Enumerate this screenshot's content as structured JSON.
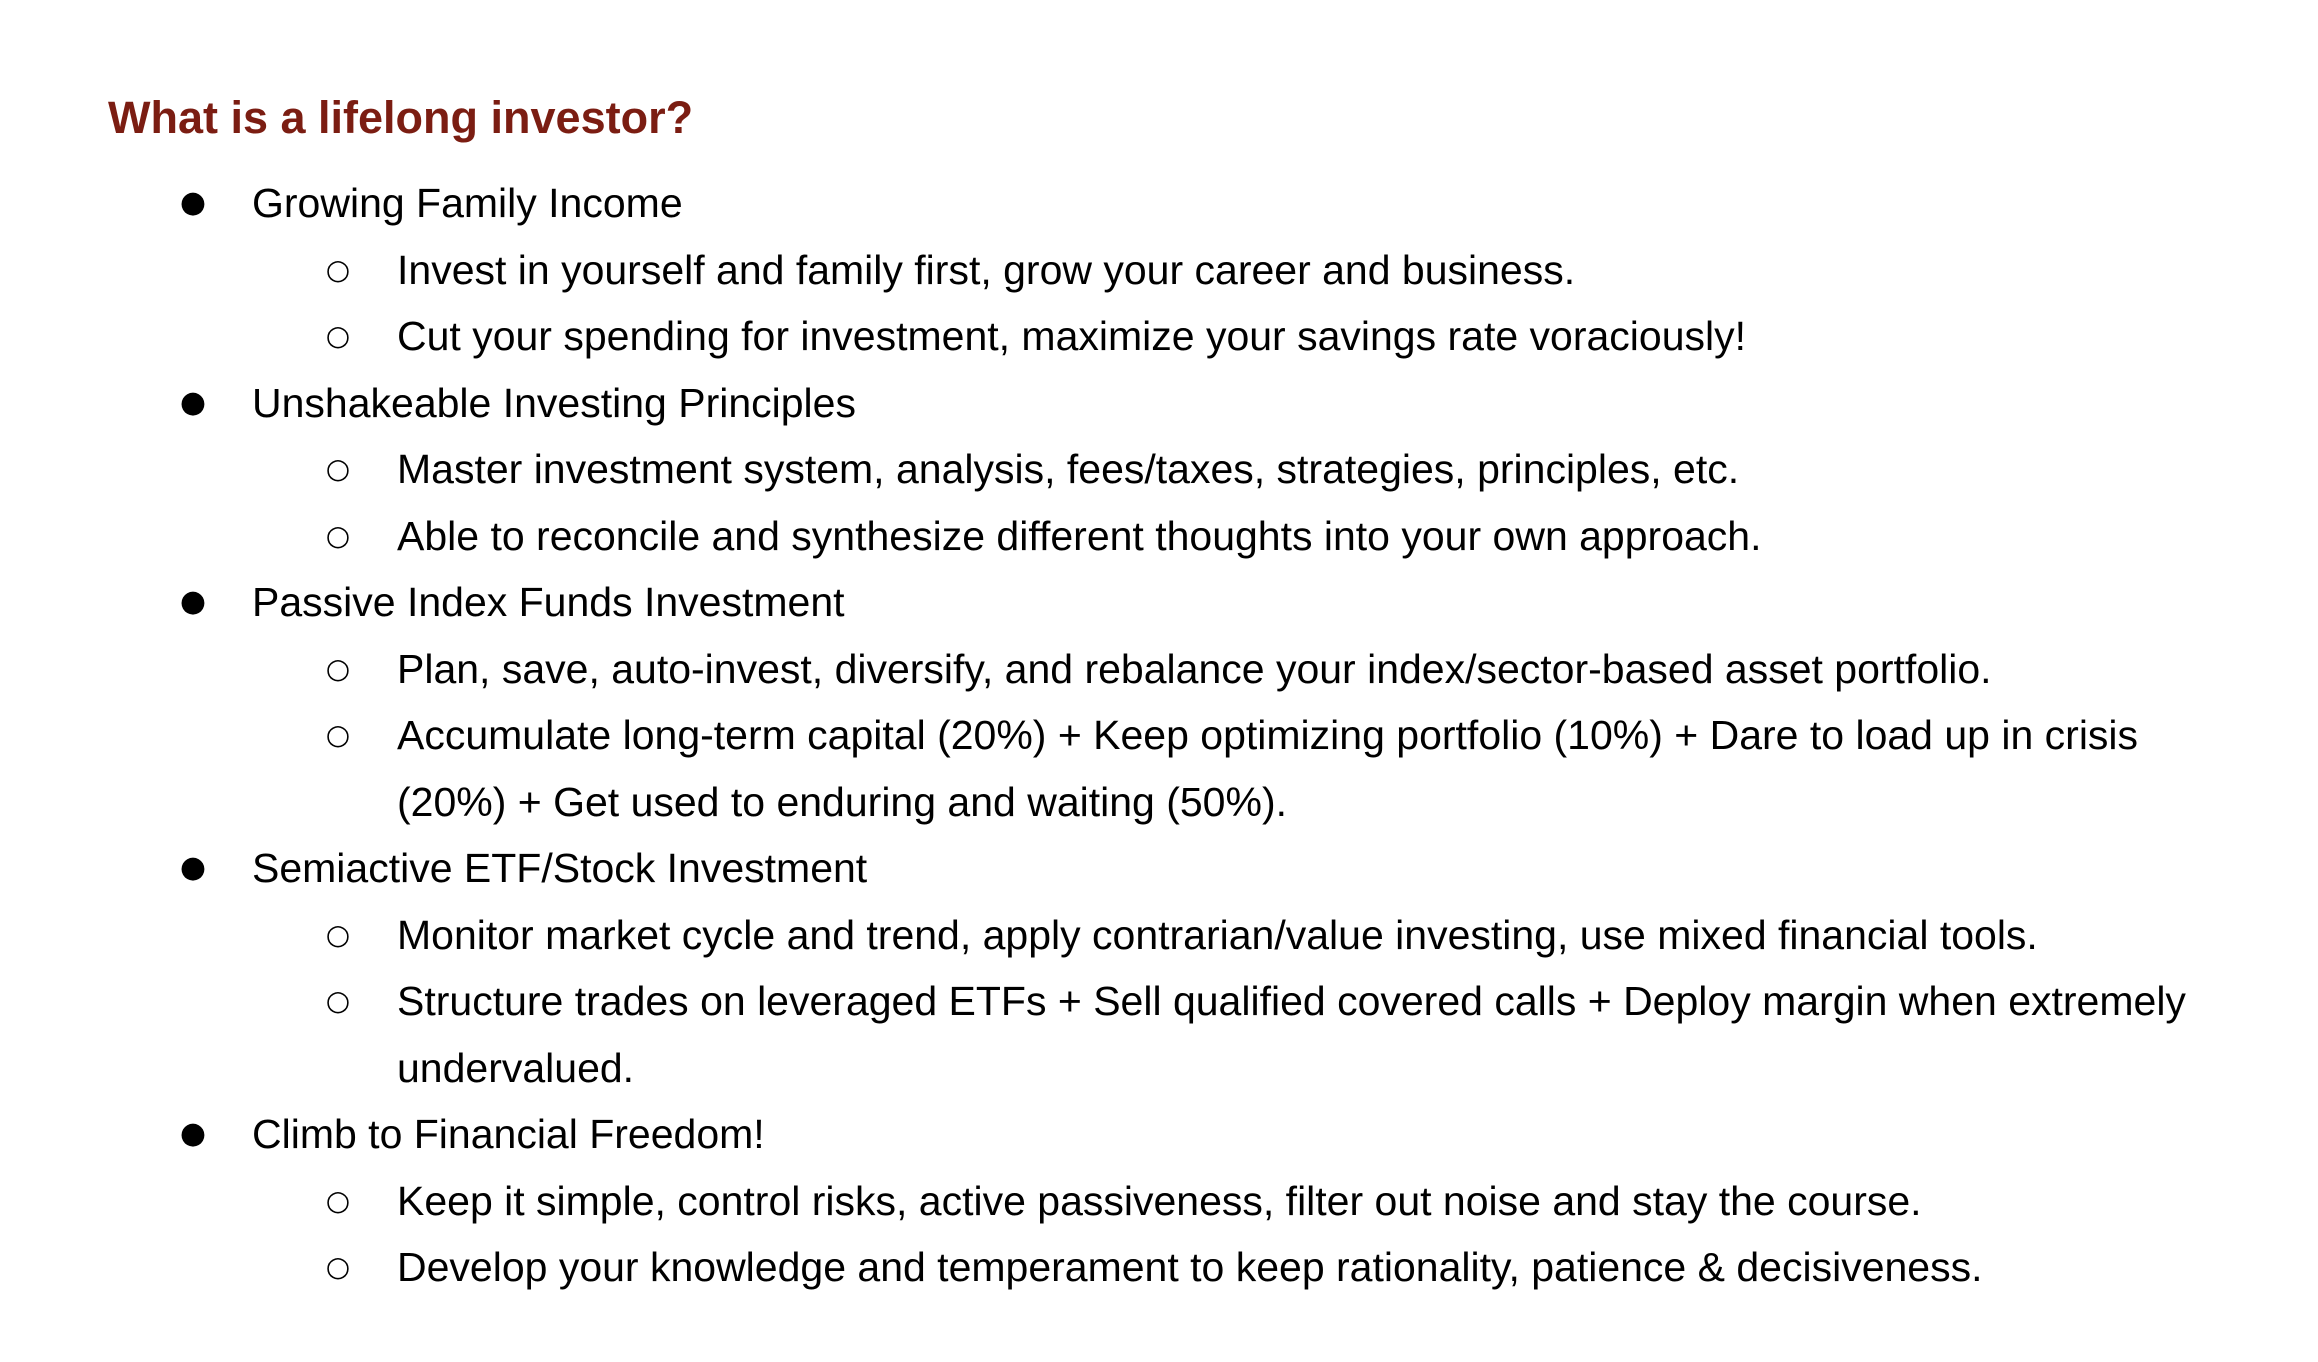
{
  "heading": "What is a lifelong investor?",
  "bullets": {
    "filled": "●",
    "hollow": "○"
  },
  "sections": [
    {
      "title": "Growing Family Income",
      "items": [
        "Invest in yourself and family first, grow your career and business.",
        "Cut your spending for investment, maximize your savings rate voraciously!"
      ]
    },
    {
      "title": "Unshakeable Investing Principles",
      "items": [
        "Master investment system, analysis, fees/taxes, strategies, principles, etc.",
        "Able to reconcile and synthesize different thoughts into your own approach."
      ]
    },
    {
      "title": "Passive Index Funds Investment",
      "items": [
        "Plan, save, auto-invest, diversify, and rebalance your index/sector-based asset portfolio.",
        "Accumulate long-term capital (20%) + Keep optimizing portfolio (10%) + Dare to load up in crisis (20%) + Get used to enduring and waiting (50%)."
      ]
    },
    {
      "title": "Semiactive ETF/Stock Investment",
      "items": [
        "Monitor market cycle and trend, apply contrarian/value investing, use mixed financial tools.",
        "Structure trades on leveraged ETFs + Sell qualified covered calls + Deploy margin when extremely undervalued."
      ]
    },
    {
      "title": "Climb to Financial Freedom!",
      "items": [
        "Keep it simple, control risks, active passiveness, filter out noise and stay the course.",
        "Develop your knowledge and temperament to keep rationality, patience & decisiveness."
      ]
    }
  ]
}
